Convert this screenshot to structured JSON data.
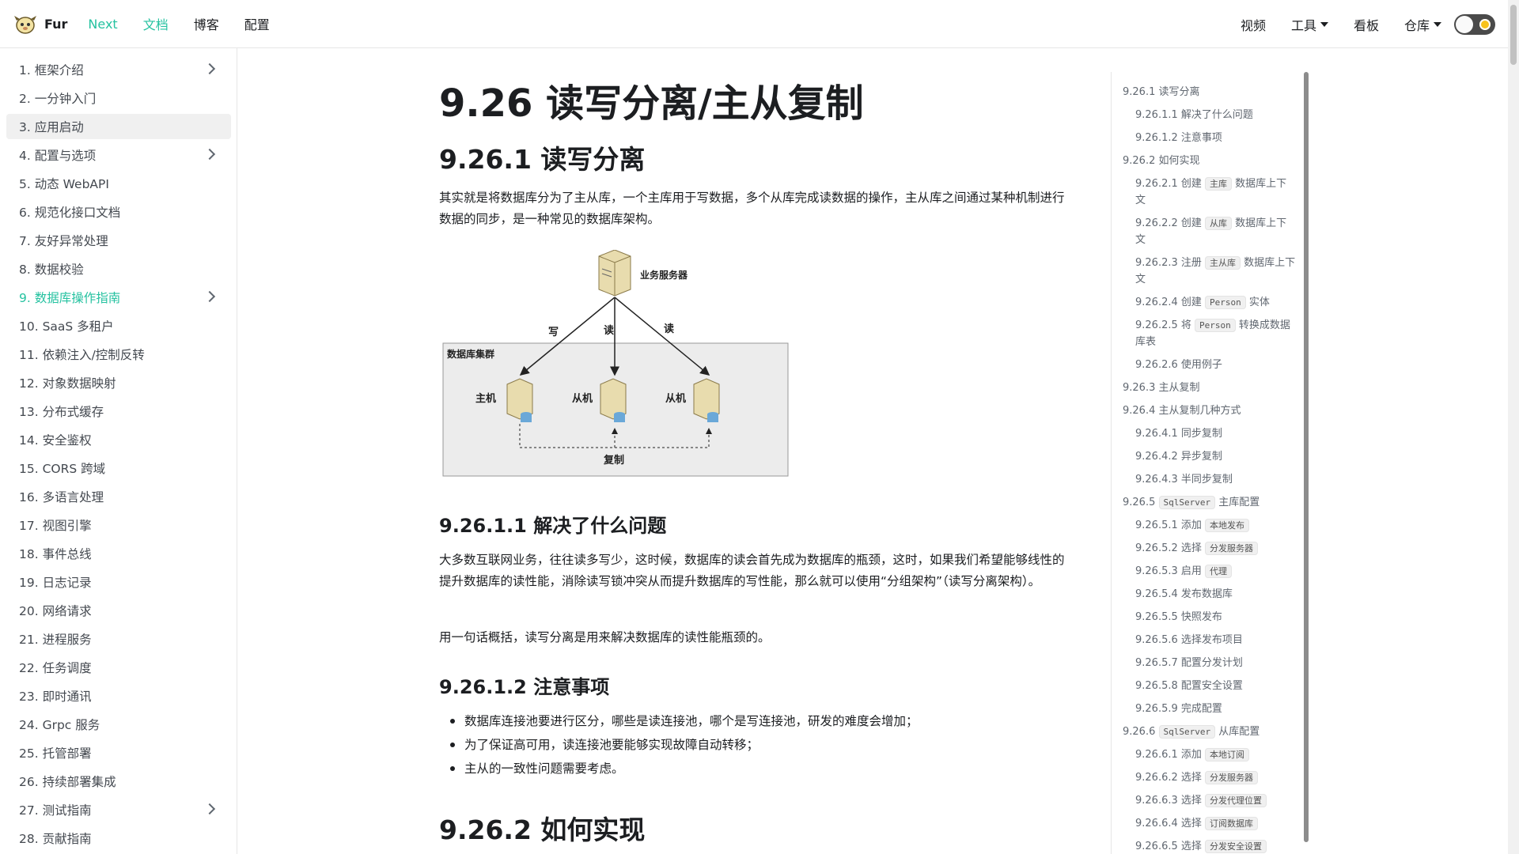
{
  "navbar": {
    "brand": "Fur",
    "left": [
      {
        "label": "Next",
        "green": true
      },
      {
        "label": "文档",
        "green": true
      },
      {
        "label": "博客",
        "green": false
      },
      {
        "label": "配置",
        "green": false
      }
    ],
    "right": {
      "video": "视频",
      "tools": "工具",
      "board": "看板",
      "repo": "仓库"
    }
  },
  "sidebar": {
    "items": [
      "1. 框架介绍",
      "2. 一分钟入门",
      "3. 应用启动",
      "4. 配置与选项",
      "5. 动态 WebAPI",
      "6. 规范化接口文档",
      "7. 友好异常处理",
      "8. 数据校验",
      "9. 数据库操作指南",
      "10. SaaS 多租户",
      "11. 依赖注入/控制反转",
      "12. 对象数据映射",
      "13. 分布式缓存",
      "14. 安全鉴权",
      "15. CORS 跨域",
      "16. 多语言处理",
      "17. 视图引擎",
      "18. 事件总线",
      "19. 日志记录",
      "20. 网络请求",
      "21. 进程服务",
      "22. 任务调度",
      "23. 即时通讯",
      "24. Grpc 服务",
      "25. 托管部署",
      "26. 持续部署集成",
      "27. 测试指南",
      "28. 贡献指南"
    ]
  },
  "article": {
    "title": "9.26 读写分离/主从复制",
    "h_rw": "9.26.1 读写分离",
    "p_intro": "其实就是将数据库分为了主从库，一个主库用于写数据，多个从库完成读数据的操作，主从库之间通过某种机制进行数据的同步，是一种常见的数据库架构。",
    "diagram": {
      "server": "业务服务器",
      "cluster": "数据库集群",
      "write": "写",
      "read1": "读",
      "read2": "读",
      "master": "主机",
      "slave1": "从机",
      "slave2": "从机",
      "replicate": "复制"
    },
    "h_problem": "9.26.1.1 解决了什么问题",
    "p_problem": "大多数互联网业务，往往读多写少，这时候，数据库的读会首先成为数据库的瓶颈，这时，如果我们希望能够线性的提升数据库的读性能，消除读写锁冲突从而提升数据库的写性能，那么就可以使用“分组架构”（读写分离架构）。",
    "p_summary": "用一句话概括，读写分离是用来解决数据库的读性能瓶颈的。",
    "h_notes": "9.26.1.2 注意事项",
    "notes": [
      "数据库连接池要进行区分，哪些是读连接池，哪个是写连接池，研发的难度会增加；",
      "为了保证高可用，读连接池要能够实现故障自动转移；",
      "主从的一致性问题需要考虑。"
    ],
    "h_impl": "9.26.2 如何实现"
  },
  "toc": {
    "t1": "9.26.1 读写分离",
    "t2": "9.26.1.1 解决了什么问题",
    "t3": "9.26.1.2 注意事项",
    "t4": "9.26.2 如何实现",
    "t5a": "9.26.2.1 创建",
    "t5c": "主库",
    "t5b": "数据库上下",
    "t5d": "文",
    "t6a": "9.26.2.2 创建",
    "t6c": "从库",
    "t6b": "数据库上下",
    "t6d": "文",
    "t7a": "9.26.2.3 注册",
    "t7c": "主从库",
    "t7b": "数据库上下",
    "t7d": "文",
    "t8a": "9.26.2.4 创建",
    "t8c": "Person",
    "t8b": "实体",
    "t9a": "9.26.2.5 将",
    "t9c": "Person",
    "t9b": "转换成数据",
    "t9d": "库表",
    "t10": "9.26.2.6 使用例子",
    "t11": "9.26.3 主从复制",
    "t12": "9.26.4 主从复制几种方式",
    "t13": "9.26.4.1 同步复制",
    "t14": "9.26.4.2 异步复制",
    "t15": "9.26.4.3 半同步复制",
    "t16a": "9.26.5",
    "t16c": "SqlServer",
    "t16b": "主库配置",
    "t17a": "9.26.5.1 添加",
    "t17c": "本地发布",
    "t18a": "9.26.5.2 选择",
    "t18c": "分发服务器",
    "t19a": "9.26.5.3 启用",
    "t19c": "代理",
    "t20": "9.26.5.4 发布数据库",
    "t21": "9.26.5.5 快照发布",
    "t22": "9.26.5.6 选择发布项目",
    "t23": "9.26.5.7 配置分发计划",
    "t24": "9.26.5.8 配置安全设置",
    "t25": "9.26.5.9 完成配置",
    "t26a": "9.26.6",
    "t26c": "SqlServer",
    "t26b": "从库配置",
    "t27a": "9.26.6.1 添加",
    "t27c": "本地订阅",
    "t28a": "9.26.6.2 选择",
    "t28c": "分发服务器",
    "t29a": "9.26.6.3 选择",
    "t29c": "分发代理位置",
    "t30a": "9.26.6.4 选择",
    "t30c": "订阅数据库",
    "t31a": "9.26.6.5 选择",
    "t31c": "分发安全设置"
  }
}
